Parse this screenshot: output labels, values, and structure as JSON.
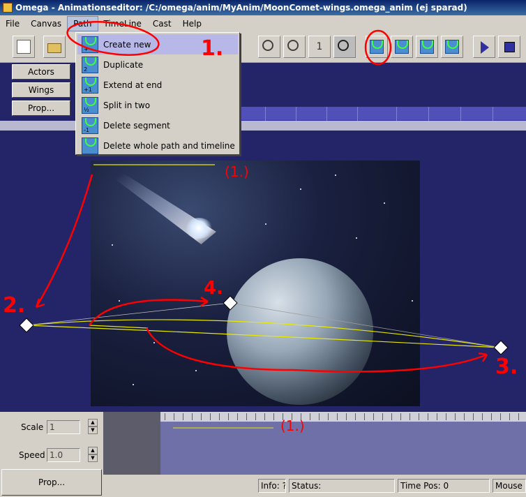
{
  "window": {
    "title": "Omega - Animationseditor: /C:/omega/anim/MyAnim/MoonComet-wings.omega_anim (ej sparad)"
  },
  "menubar": {
    "items": [
      "File",
      "Canvas",
      "Path",
      "TimeLine",
      "Cast",
      "Help"
    ],
    "active": "Path"
  },
  "path_menu": {
    "items": [
      {
        "label": "Create new",
        "icon": "path-create-icon",
        "badge": "+"
      },
      {
        "label": "Duplicate",
        "icon": "path-duplicate-icon",
        "badge": "2"
      },
      {
        "label": "Extend at end",
        "icon": "path-extend-icon",
        "badge": "+1"
      },
      {
        "label": "Split in two",
        "icon": "path-split-icon",
        "badge": "½"
      },
      {
        "label": "Delete segment",
        "icon": "path-delete-segment-icon",
        "badge": "-1"
      },
      {
        "label": "Delete whole path and timeline",
        "icon": "path-delete-all-icon",
        "badge": ""
      }
    ]
  },
  "toolbar": {
    "zoom_one": "1",
    "path_badges": [
      "+",
      "2",
      "+1",
      "½"
    ]
  },
  "left_panel": {
    "actors": "Actors",
    "wings": "Wings",
    "prop": "Prop..."
  },
  "controls": {
    "scale_label": "Scale",
    "scale_value": "1",
    "speed_label": "Speed",
    "speed_value": "1.0",
    "prop_button": "Prop..."
  },
  "status": {
    "info": "Info: ?",
    "status": "Status:",
    "time_pos": "Time Pos: 0",
    "mouse": "Mouse P"
  },
  "annotations": {
    "step1": "1.",
    "step2": "2.",
    "step3": "3.",
    "step4": "4.",
    "path_label_top": "(1.)",
    "path_label_timeline": "(1.)"
  },
  "colors": {
    "annotation": "#ff0000",
    "path": "#e8e800",
    "canvas": "#242468"
  }
}
